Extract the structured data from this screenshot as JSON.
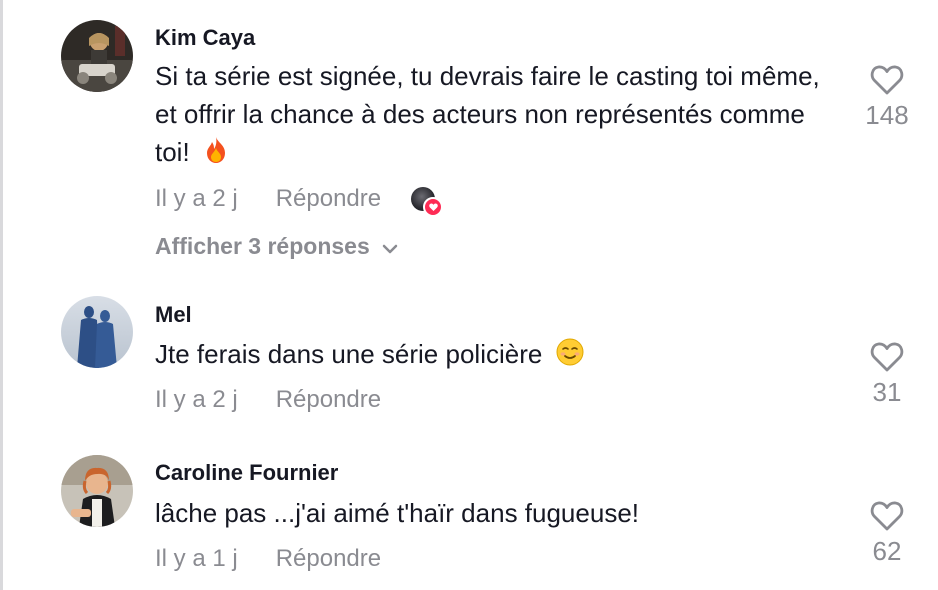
{
  "comments": [
    {
      "username": "Kim Caya",
      "text": "Si ta série est signée, tu devrais faire le casting toi même, et offrir la chance à des acteurs non représentés comme toi!",
      "emoji": "fire-emoji",
      "time": "Il y a 2 j",
      "reply_label": "Répondre",
      "like_count": "148",
      "creator_liked": true,
      "view_replies_label": "Afficher 3 réponses"
    },
    {
      "username": "Mel",
      "text": "Jte ferais dans une série policière",
      "emoji": "smiling-face-emoji",
      "time": "Il y a 2 j",
      "reply_label": "Répondre",
      "like_count": "31"
    },
    {
      "username": "Caroline Fournier",
      "text": "lâche pas ...j'ai aimé t'haïr dans fugueuse!",
      "time": "Il y a 1 j",
      "reply_label": "Répondre",
      "like_count": "62"
    }
  ],
  "colors": {
    "text_primary": "#161823",
    "text_secondary": "#8a8b91",
    "accent": "#fe2c55",
    "background": "#ffffff"
  },
  "icons": [
    "heart-outline-icon",
    "chevron-down-icon",
    "creator-liked-heart-icon"
  ]
}
